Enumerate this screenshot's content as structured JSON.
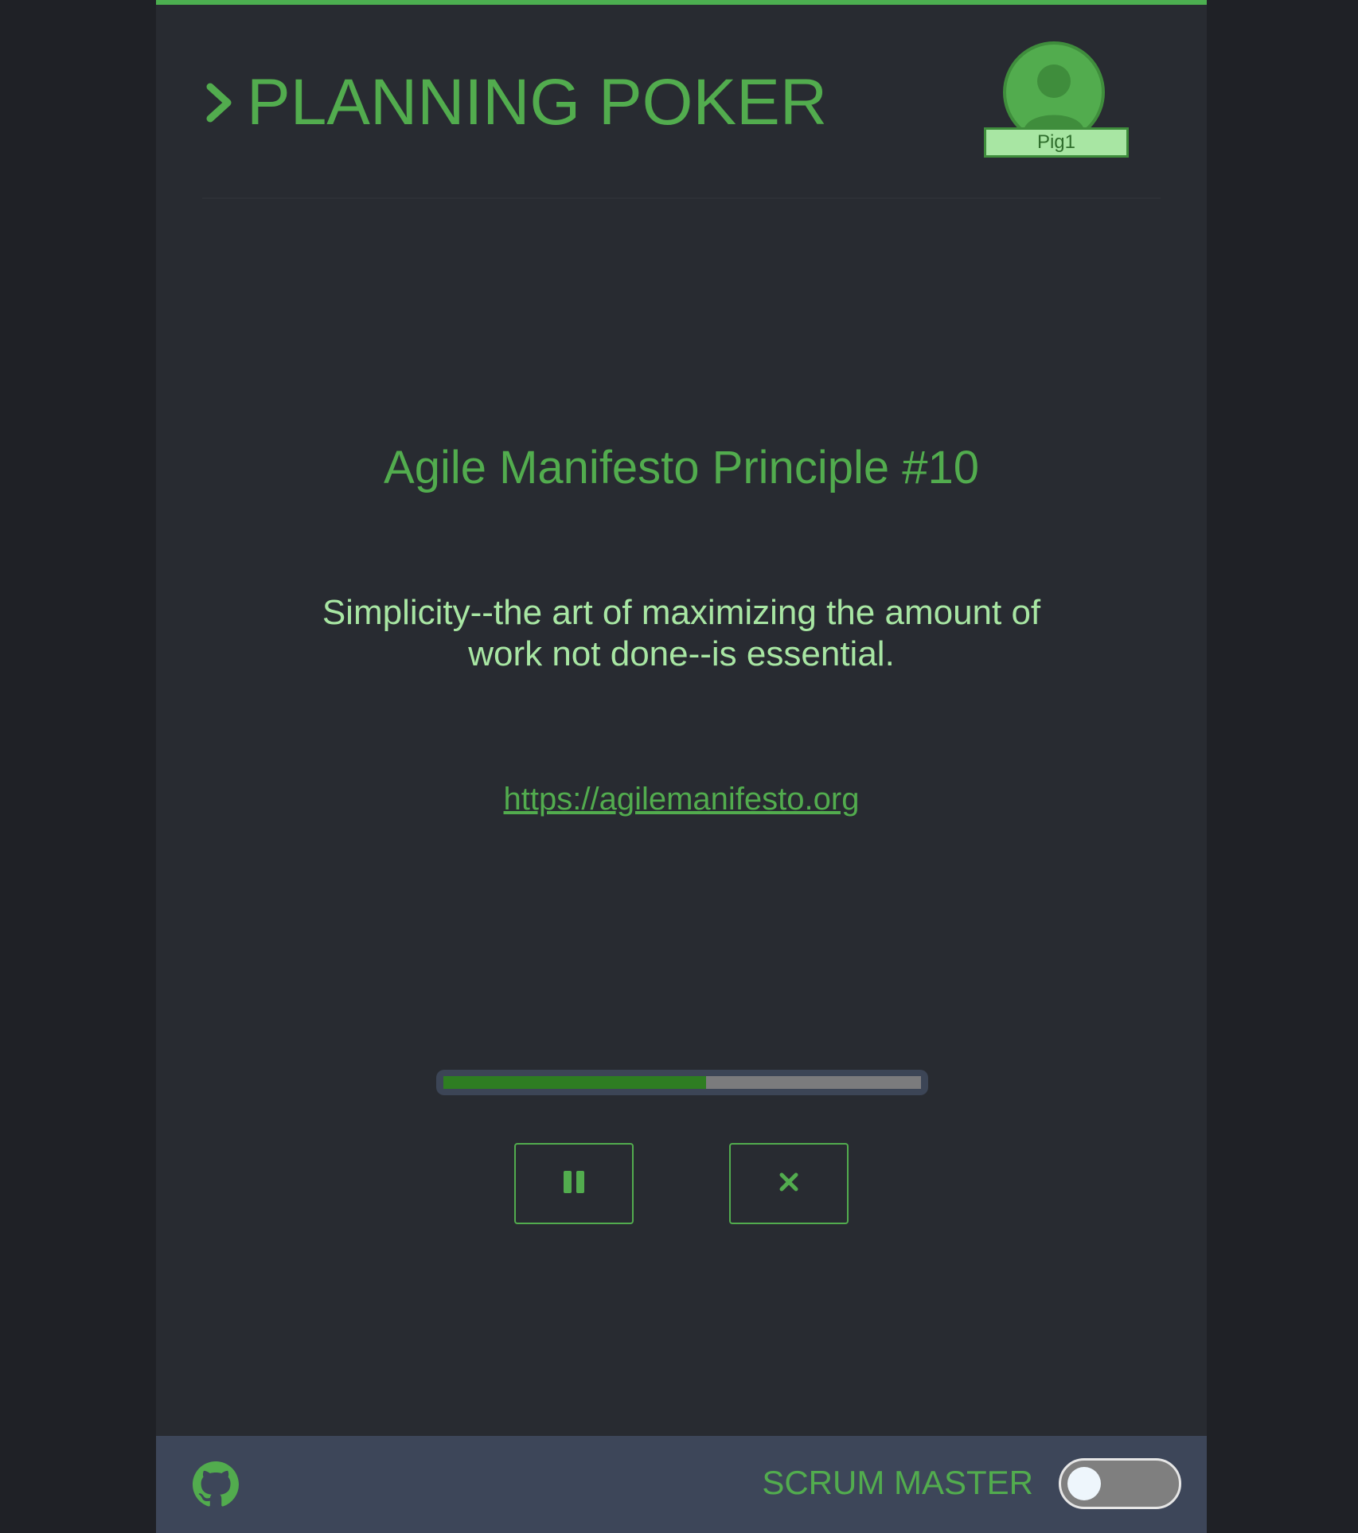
{
  "header": {
    "title": "PLANNING POKER",
    "user": {
      "name": "Pig1",
      "icon": "user-avatar-icon"
    }
  },
  "principle": {
    "title": "Agile Manifesto Principle #10",
    "text": "Simplicity--the art of maximizing the amount of work not done--is essential.",
    "link": "https://agilemanifesto.org"
  },
  "timer": {
    "progress_fraction": 0.55,
    "pause_icon": "pause-icon",
    "close_icon": "close-icon"
  },
  "footer": {
    "github_icon": "github-icon",
    "scrum_master_label": "SCRUM MASTER",
    "scrum_master_toggle_on": false
  },
  "colors": {
    "accent": "#52ac4e",
    "accent_light": "#a8e6a3",
    "background": "#282b31",
    "footer": "#3d4659",
    "progress_fill": "#2e7d22"
  }
}
